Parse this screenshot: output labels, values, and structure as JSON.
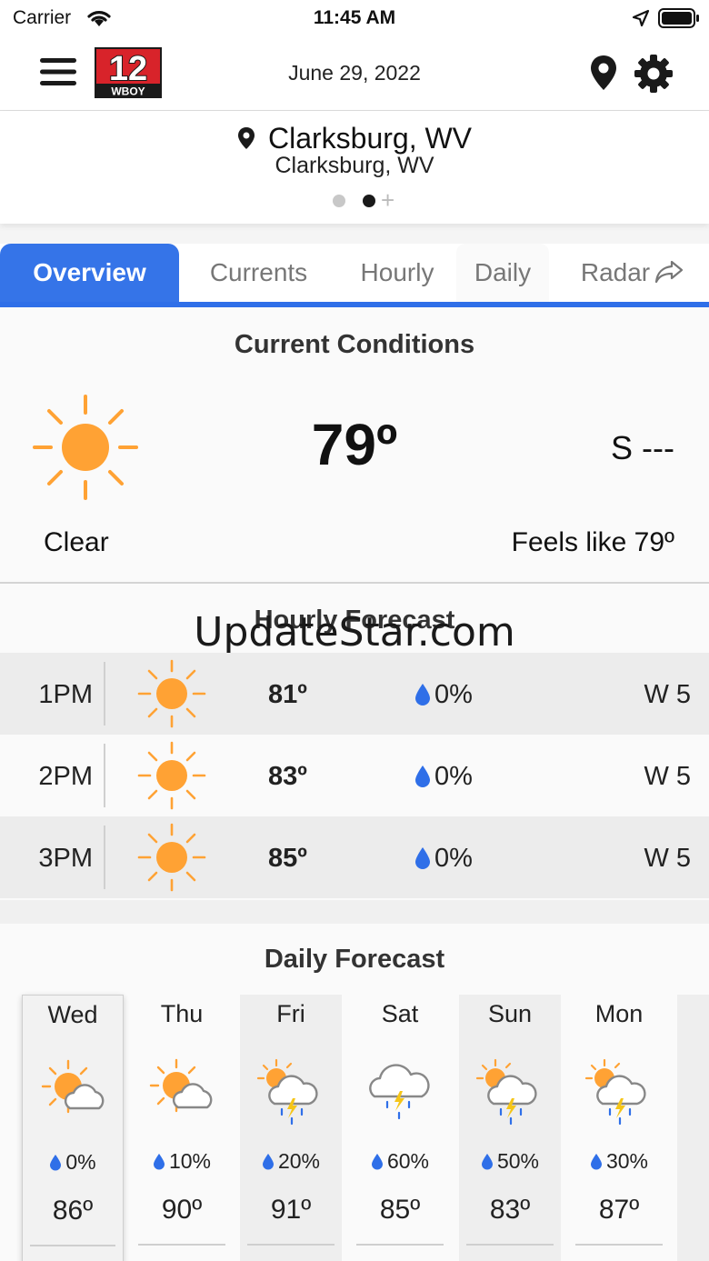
{
  "status_bar": {
    "carrier": "Carrier",
    "time": "11:45 AM"
  },
  "header": {
    "logo_number": "12",
    "logo_text": "WBOY",
    "date": "June 29, 2022"
  },
  "location": {
    "city": "Clarksburg, WV",
    "subtitle": "Clarksburg, WV",
    "page_count": 2,
    "active_page": 2
  },
  "tabs": [
    {
      "label": "Overview",
      "active": true
    },
    {
      "label": "Currents",
      "active": false
    },
    {
      "label": "Hourly",
      "active": false
    },
    {
      "label": "Daily",
      "active": false
    },
    {
      "label": "Radar",
      "active": false
    }
  ],
  "current": {
    "title": "Current Conditions",
    "temperature": "79º",
    "wind": "S ---",
    "condition": "Clear",
    "feels_like": "Feels like 79º",
    "icon": "sun-icon"
  },
  "hourly": {
    "title": "Hourly Forecast",
    "watermark": "UpdateStar.com",
    "rows": [
      {
        "hour": "1PM",
        "temp": "81º",
        "precip": "0%",
        "wind": "W 5",
        "icon": "sun-icon"
      },
      {
        "hour": "2PM",
        "temp": "83º",
        "precip": "0%",
        "wind": "W 5",
        "icon": "sun-icon"
      },
      {
        "hour": "3PM",
        "temp": "85º",
        "precip": "0%",
        "wind": "W 5",
        "icon": "sun-icon"
      }
    ]
  },
  "daily": {
    "title": "Daily Forecast",
    "days": [
      {
        "day": "Wed",
        "precip": "0%",
        "temp": "86º",
        "icon": "partly-cloudy-icon"
      },
      {
        "day": "Thu",
        "precip": "10%",
        "temp": "90º",
        "icon": "partly-cloudy-icon"
      },
      {
        "day": "Fri",
        "precip": "20%",
        "temp": "91º",
        "icon": "sun-thunderstorm-icon"
      },
      {
        "day": "Sat",
        "precip": "60%",
        "temp": "85º",
        "icon": "thunderstorm-icon"
      },
      {
        "day": "Sun",
        "precip": "50%",
        "temp": "83º",
        "icon": "sun-thunderstorm-icon"
      },
      {
        "day": "Mon",
        "precip": "30%",
        "temp": "87º",
        "icon": "sun-thunderstorm-icon"
      }
    ]
  },
  "colors": {
    "accent": "#3574e8",
    "sun": "#ffa234",
    "drop": "#2f6fe8",
    "tab_border": "#2f6fe8"
  }
}
